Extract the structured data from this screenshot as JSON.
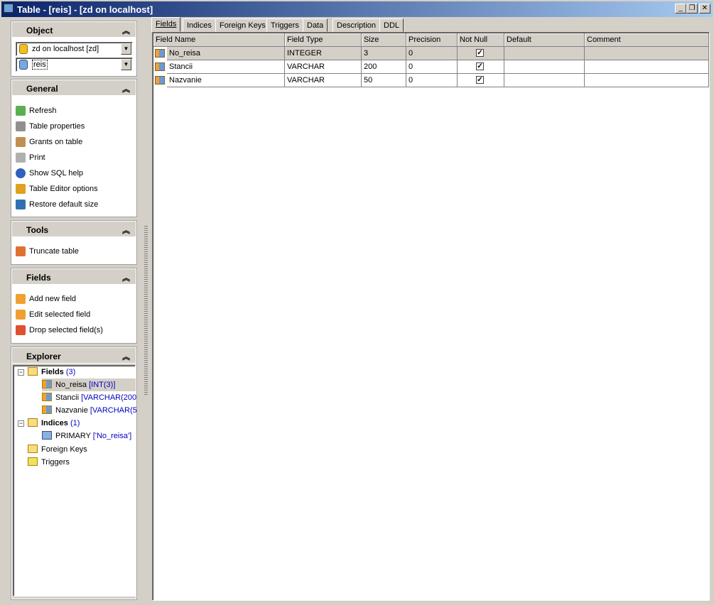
{
  "window": {
    "title": "Table - [reis] - [zd on localhost]"
  },
  "object": {
    "title": "Object",
    "database": "zd on localhost [zd]",
    "table": "reis"
  },
  "general": {
    "title": "General",
    "items": [
      "Refresh",
      "Table properties",
      "Grants on table",
      "Print",
      "Show SQL help",
      "Table Editor options",
      "Restore default size"
    ]
  },
  "tools": {
    "title": "Tools",
    "items": [
      "Truncate table"
    ]
  },
  "fields_panel": {
    "title": "Fields",
    "items": [
      "Add new field",
      "Edit selected field",
      "Drop selected field(s)"
    ]
  },
  "explorer": {
    "title": "Explorer",
    "fields_label": "Fields",
    "fields_count": "(3)",
    "fields": [
      {
        "name": "No_reisa",
        "type": "[INT(3)]"
      },
      {
        "name": "Stancii",
        "type": "[VARCHAR(200"
      },
      {
        "name": "Nazvanie",
        "type": "[VARCHAR(5"
      }
    ],
    "indices_label": "Indices",
    "indices_count": "(1)",
    "index": {
      "name": "PRIMARY",
      "cols": "['No_reisa']"
    },
    "foreign_keys": "Foreign Keys",
    "triggers": "Triggers"
  },
  "tabs": [
    "Fields",
    "Indices",
    "Foreign Keys",
    "Triggers",
    "Data",
    "Description",
    "DDL"
  ],
  "grid": {
    "columns": [
      "Field Name",
      "Field Type",
      "Size",
      "Precision",
      "Not Null",
      "Default",
      "Comment"
    ],
    "rows": [
      {
        "name": "No_reisa",
        "type": "INTEGER",
        "size": "3",
        "precision": "0",
        "not_null": true,
        "default": "",
        "comment": ""
      },
      {
        "name": "Stancii",
        "type": "VARCHAR",
        "size": "200",
        "precision": "0",
        "not_null": true,
        "default": "",
        "comment": ""
      },
      {
        "name": "Nazvanie",
        "type": "VARCHAR",
        "size": "50",
        "precision": "0",
        "not_null": true,
        "default": "",
        "comment": ""
      }
    ]
  }
}
